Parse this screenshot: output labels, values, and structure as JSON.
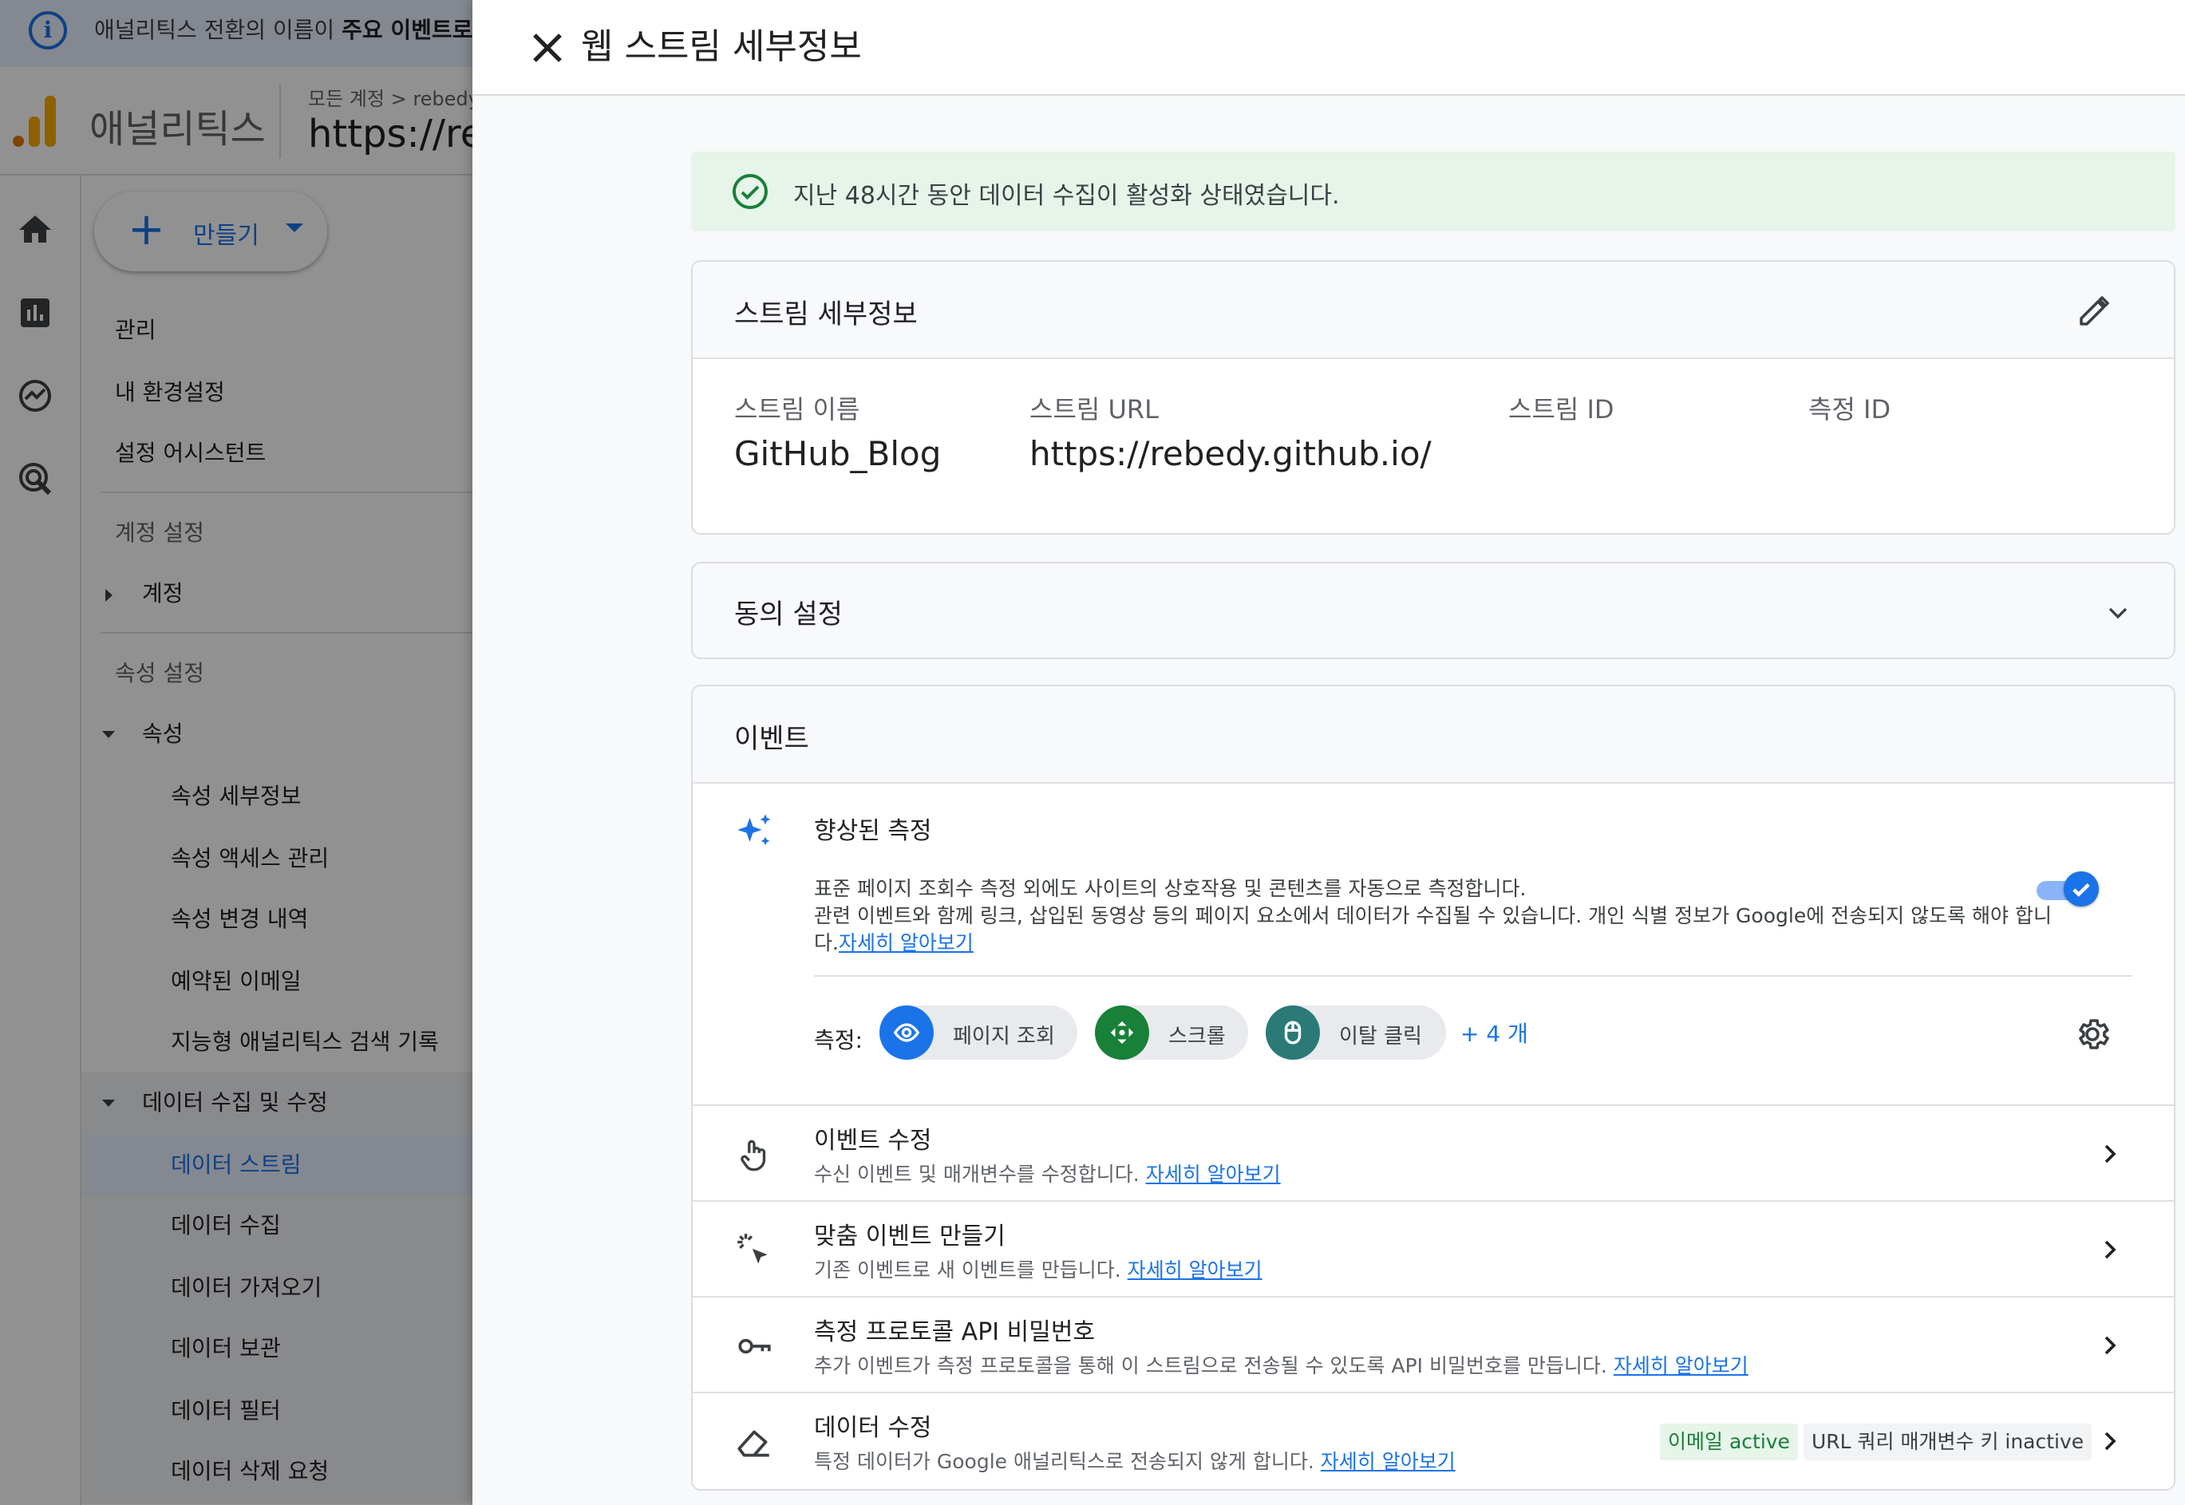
{
  "info_banner": {
    "text": "애널리틱스 전환의 이름이 ",
    "bold": "주요 이벤트로"
  },
  "app": {
    "product_name": "애널리틱스",
    "breadcrumb": "모든 계정 > rebedy",
    "property_title": "https://rebedy.github.io"
  },
  "nav": {
    "create_label": "만들기",
    "items": [
      "관리",
      "내 환경설정",
      "설정 어시스턴트"
    ],
    "account_section": "계정 설정",
    "account_item": "계정",
    "property_section": "속성 설정",
    "property_item": "속성",
    "property_children": [
      "속성 세부정보",
      "속성 액세스 관리",
      "속성 변경 내역",
      "예약된 이메일",
      "지능형 애널리틱스 검색 기록"
    ],
    "data_group": "데이터 수집 및 수정",
    "data_children": [
      "데이터 스트림",
      "데이터 수집",
      "데이터 가져오기",
      "데이터 보관",
      "데이터 필터",
      "데이터 삭제 요청"
    ]
  },
  "sheet": {
    "title": "웹 스트림 세부정보",
    "status": "지난 48시간 동안 데이터 수집이 활성화 상태였습니다.",
    "stream_details": {
      "title": "스트림 세부정보",
      "fields": [
        {
          "label": "스트림 이름",
          "value": "GitHub_Blog"
        },
        {
          "label": "스트림 URL",
          "value": "https://rebedy.github.io/"
        },
        {
          "label": "스트림 ID",
          "value": ""
        },
        {
          "label": "측정 ID",
          "value": ""
        }
      ]
    },
    "consent": {
      "title": "동의 설정"
    },
    "events": {
      "title": "이벤트",
      "enhanced": {
        "title": "향상된 측정",
        "desc1": "표준 페이지 조회수 측정 외에도 사이트의 상호작용 및 콘텐츠를 자동으로 측정합니다.",
        "desc2": "관련 이벤트와 함께 링크, 삽입된 동영상 등의 페이지 요소에서 데이터가 수집될 수 있습니다. 개인 식별 정보가 Google에 전송되지 않도록 해야 합니",
        "desc3": "다.",
        "link": "자세히 알아보기",
        "enabled": true
      },
      "measure_label": "측정:",
      "chips": [
        "페이지 조회",
        "스크롤",
        "이탈 클릭"
      ],
      "more": "+ 4 개",
      "rows": [
        {
          "title": "이벤트 수정",
          "desc": "수신 이벤트 및 매개변수를 수정합니다. ",
          "link": "자세히 알아보기"
        },
        {
          "title": "맞춤 이벤트 만들기",
          "desc": "기존 이벤트로 새 이벤트를 만듭니다. ",
          "link": "자세히 알아보기"
        },
        {
          "title": "측정 프로토콜 API 비밀번호",
          "desc": "추가 이벤트가 측정 프로토콜을 통해 이 스트림으로 전송될 수 있도록 API 비밀번호를 만듭니다. ",
          "link": "자세히 알아보기"
        },
        {
          "title": "데이터 수정",
          "desc": "특정 데이터가 Google 애널리틱스로 전송되지 않게 합니다. ",
          "link": "자세히 알아보기",
          "badges": [
            "이메일 active",
            "URL 쿼리 매개변수 키 inactive"
          ]
        }
      ]
    }
  },
  "colors": {
    "accent": "#1a73e8",
    "success_bg": "#e6f4ea",
    "success": "#188038",
    "chip_teal": "#2b7a78"
  }
}
